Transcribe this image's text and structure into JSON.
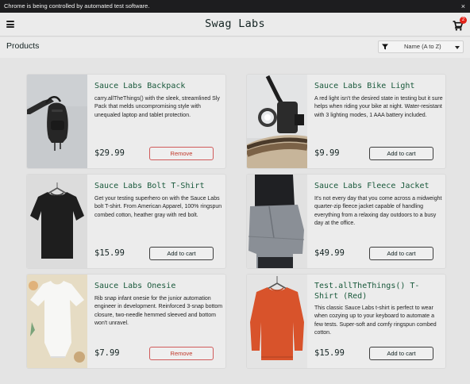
{
  "browser": {
    "automation_notice": "Chrome is being controlled by automated test software.",
    "close_glyph": "×"
  },
  "header": {
    "menu_icon": "hamburger-menu-icon",
    "title": "Swag Labs",
    "cart_icon": "shopping-cart-icon",
    "cart_count": "2",
    "badge_color": "#e2231a"
  },
  "subheader": {
    "title": "Products",
    "sort_icon": "filter-funnel-icon",
    "sort_selected": "Name (A to Z)"
  },
  "colors": {
    "product_name": "#18583a",
    "remove_button": "#c0392b"
  },
  "products": [
    {
      "name": "Sauce Labs Backpack",
      "description": "carry.allTheThings() with the sleek, streamlined Sly Pack that melds uncompromising style with unequaled laptop and tablet protection.",
      "price": "$29.99",
      "button": "Remove",
      "image": "black-backpack"
    },
    {
      "name": "Sauce Labs Bike Light",
      "description": "A red light isn't the desired state in testing but it sure helps when riding your bike at night. Water-resistant with 3 lighting modes, 1 AAA battery included.",
      "price": "$9.99",
      "button": "Add to cart",
      "image": "bike-light"
    },
    {
      "name": "Sauce Labs Bolt T-Shirt",
      "description": "Get your testing superhero on with the Sauce Labs bolt T-shirt. From American Apparel, 100% ringspun combed cotton, heather gray with red bolt.",
      "price": "$15.99",
      "button": "Add to cart",
      "image": "black-t-shirt"
    },
    {
      "name": "Sauce Labs Fleece Jacket",
      "description": "It's not every day that you come across a midweight quarter-zip fleece jacket capable of handling everything from a relaxing day outdoors to a busy day at the office.",
      "price": "$49.99",
      "button": "Add to cart",
      "image": "gray-fleece-jacket"
    },
    {
      "name": "Sauce Labs Onesie",
      "description": "Rib snap infant onesie for the junior automation engineer in development. Reinforced 3-snap bottom closure, two-needle hemmed sleeved and bottom won't unravel.",
      "price": "$7.99",
      "button": "Remove",
      "image": "white-onesie"
    },
    {
      "name": "Test.allTheThings() T-Shirt (Red)",
      "description": "This classic Sauce Labs t-shirt is perfect to wear when cozying up to your keyboard to automate a few tests. Super-soft and comfy ringspun combed cotton.",
      "price": "$15.99",
      "button": "Add to cart",
      "image": "red-sweatshirt"
    }
  ]
}
